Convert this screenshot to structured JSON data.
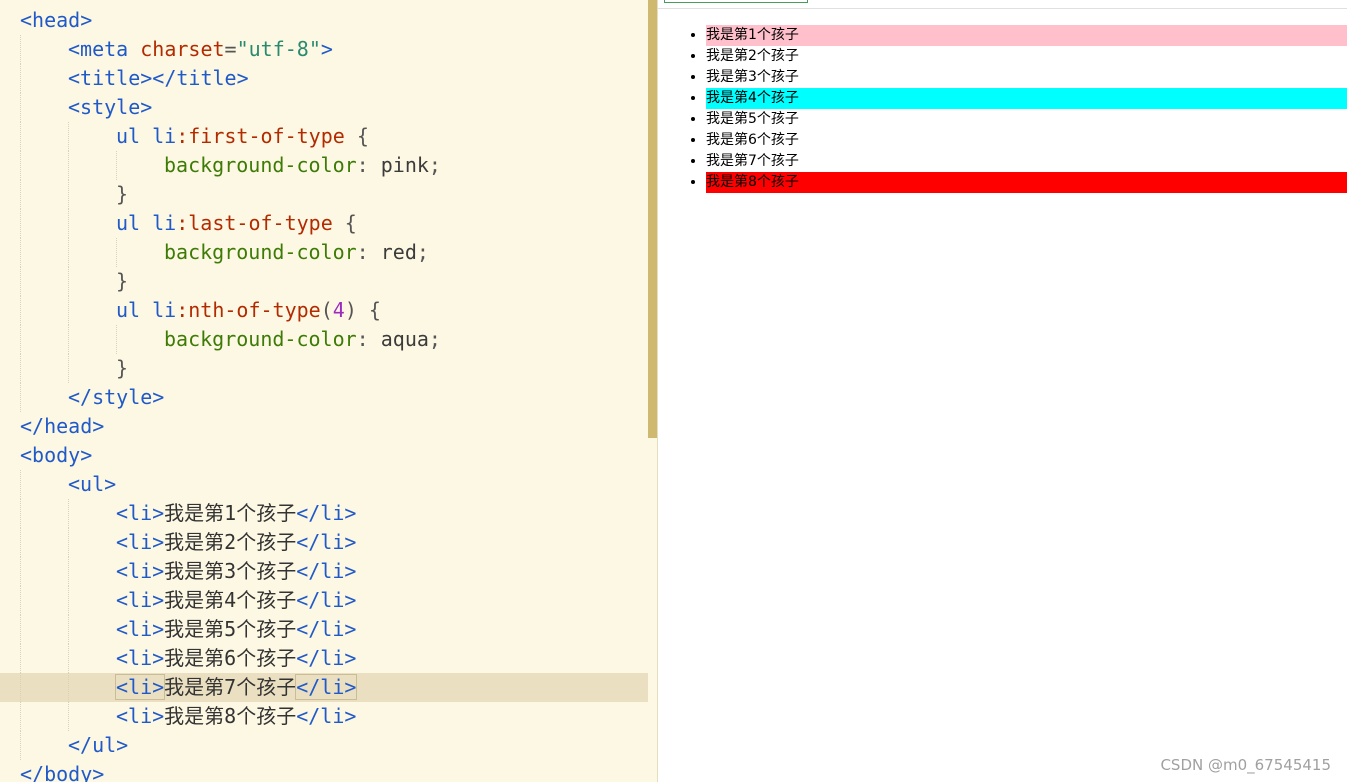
{
  "editor": {
    "lines": [
      [
        "<head>"
      ],
      [
        "<meta",
        " charset",
        "=",
        "\"utf-8\"",
        ">"
      ],
      [
        "<title>",
        "</title>"
      ],
      [
        "<style>"
      ],
      [
        "ul li",
        ":first-of-type",
        " {"
      ],
      [
        "background-color",
        ":",
        " pink",
        ";"
      ],
      [
        "}"
      ],
      [
        "ul li",
        ":last-of-type",
        " {"
      ],
      [
        "background-color",
        ":",
        " red",
        ";"
      ],
      [
        "}"
      ],
      [
        "ul li",
        ":nth-of-type",
        "(",
        "4",
        ")",
        " {"
      ],
      [
        "background-color",
        ":",
        " aqua",
        ";"
      ],
      [
        "}"
      ],
      [
        "</style>"
      ],
      [
        "</head>"
      ],
      [
        "<body>"
      ],
      [
        "<ul>"
      ],
      [
        "<li>",
        "我是第1个孩子",
        "</li>"
      ],
      [
        "<li>",
        "我是第2个孩子",
        "</li>"
      ],
      [
        "<li>",
        "我是第3个孩子",
        "</li>"
      ],
      [
        "<li>",
        "我是第4个孩子",
        "</li>"
      ],
      [
        "<li>",
        "我是第5个孩子",
        "</li>"
      ],
      [
        "<li>",
        "我是第6个孩子",
        "</li>"
      ],
      [
        "<li>",
        "我是第7个孩子",
        "</li>"
      ],
      [
        "<li>",
        "我是第8个孩子",
        "</li>"
      ],
      [
        "</ul>"
      ],
      [
        "</body>"
      ]
    ]
  },
  "preview": {
    "items": [
      {
        "label": "我是第1个孩子",
        "bg": "#ffc0cb"
      },
      {
        "label": "我是第2个孩子",
        "bg": ""
      },
      {
        "label": "我是第3个孩子",
        "bg": ""
      },
      {
        "label": "我是第4个孩子",
        "bg": "#00ffff"
      },
      {
        "label": "我是第5个孩子",
        "bg": ""
      },
      {
        "label": "我是第6个孩子",
        "bg": ""
      },
      {
        "label": "我是第7个孩子",
        "bg": ""
      },
      {
        "label": "我是第8个孩子",
        "bg": "#ff0000"
      }
    ]
  },
  "watermark": "CSDN @m0_67545415"
}
